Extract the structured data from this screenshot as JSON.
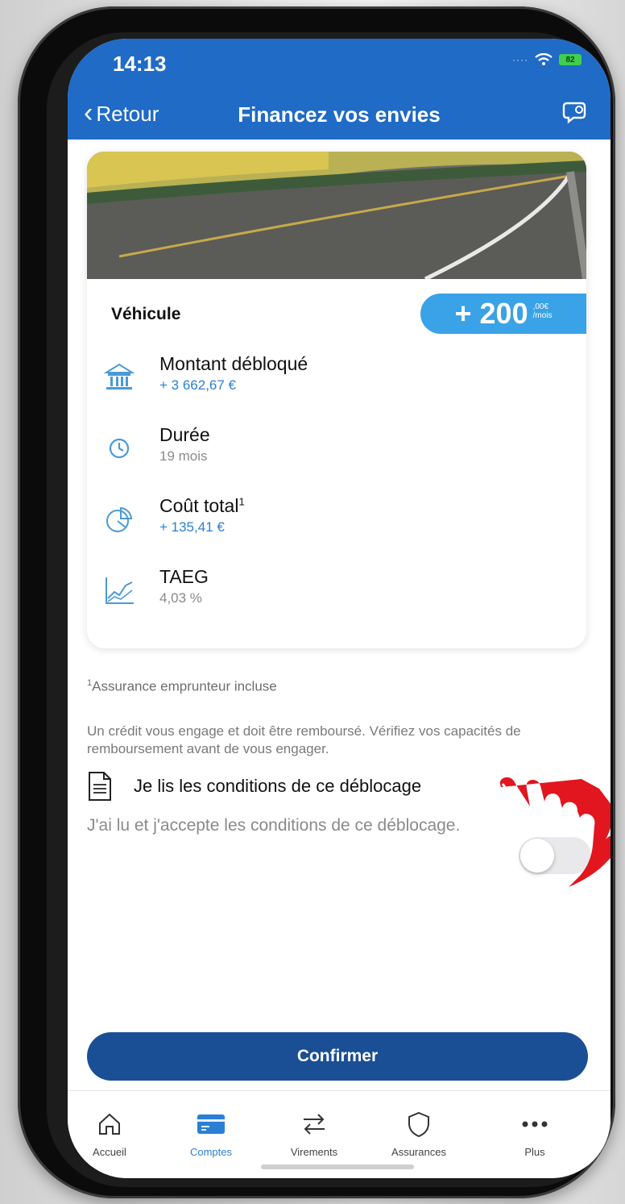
{
  "status": {
    "time": "14:13",
    "battery": "82"
  },
  "nav": {
    "back_label": "Retour",
    "title": "Financez vos envies"
  },
  "card": {
    "title": "Véhicule",
    "badge": {
      "amount": "+ 200",
      "cents": ",00€",
      "per": "/mois"
    },
    "rows": [
      {
        "label": "Montant débloqué",
        "value": "+ 3 662,67 €",
        "icon": "bank-icon"
      },
      {
        "label": "Durée",
        "value": "19 mois",
        "icon": "clock-icon"
      },
      {
        "label": "Coût total",
        "label_sup": "1",
        "value": "+ 135,41 €",
        "icon": "pie-chart-icon"
      },
      {
        "label": "TAEG",
        "value": "4,03 %",
        "icon": "line-chart-icon"
      }
    ]
  },
  "footnote": {
    "sup": "1",
    "text": "Assurance emprunteur incluse"
  },
  "warning": "Un crédit vous engage et doit être remboursé. Vérifiez vos capacités de remboursement avant de vous engager.",
  "conditions": {
    "link_label": "Je lis les conditions de ce déblocage",
    "accept_text": "J'ai lu et j'accepte les conditions de ce déblocage.",
    "accepted": false
  },
  "confirm_label": "Confirmer",
  "tabs": [
    {
      "label": "Accueil",
      "icon": "home-icon",
      "active": false
    },
    {
      "label": "Comptes",
      "icon": "card-icon",
      "active": true
    },
    {
      "label": "Virements",
      "icon": "transfer-icon",
      "active": false
    },
    {
      "label": "Assurances",
      "icon": "shield-icon",
      "active": false
    },
    {
      "label": "Plus",
      "icon": "more-icon",
      "active": false
    }
  ],
  "colors": {
    "header": "#1f6bc6",
    "accent": "#2a7fd4",
    "badge": "#3aa2e6",
    "confirm": "#1a4f96",
    "pointer": "#e1161f"
  }
}
